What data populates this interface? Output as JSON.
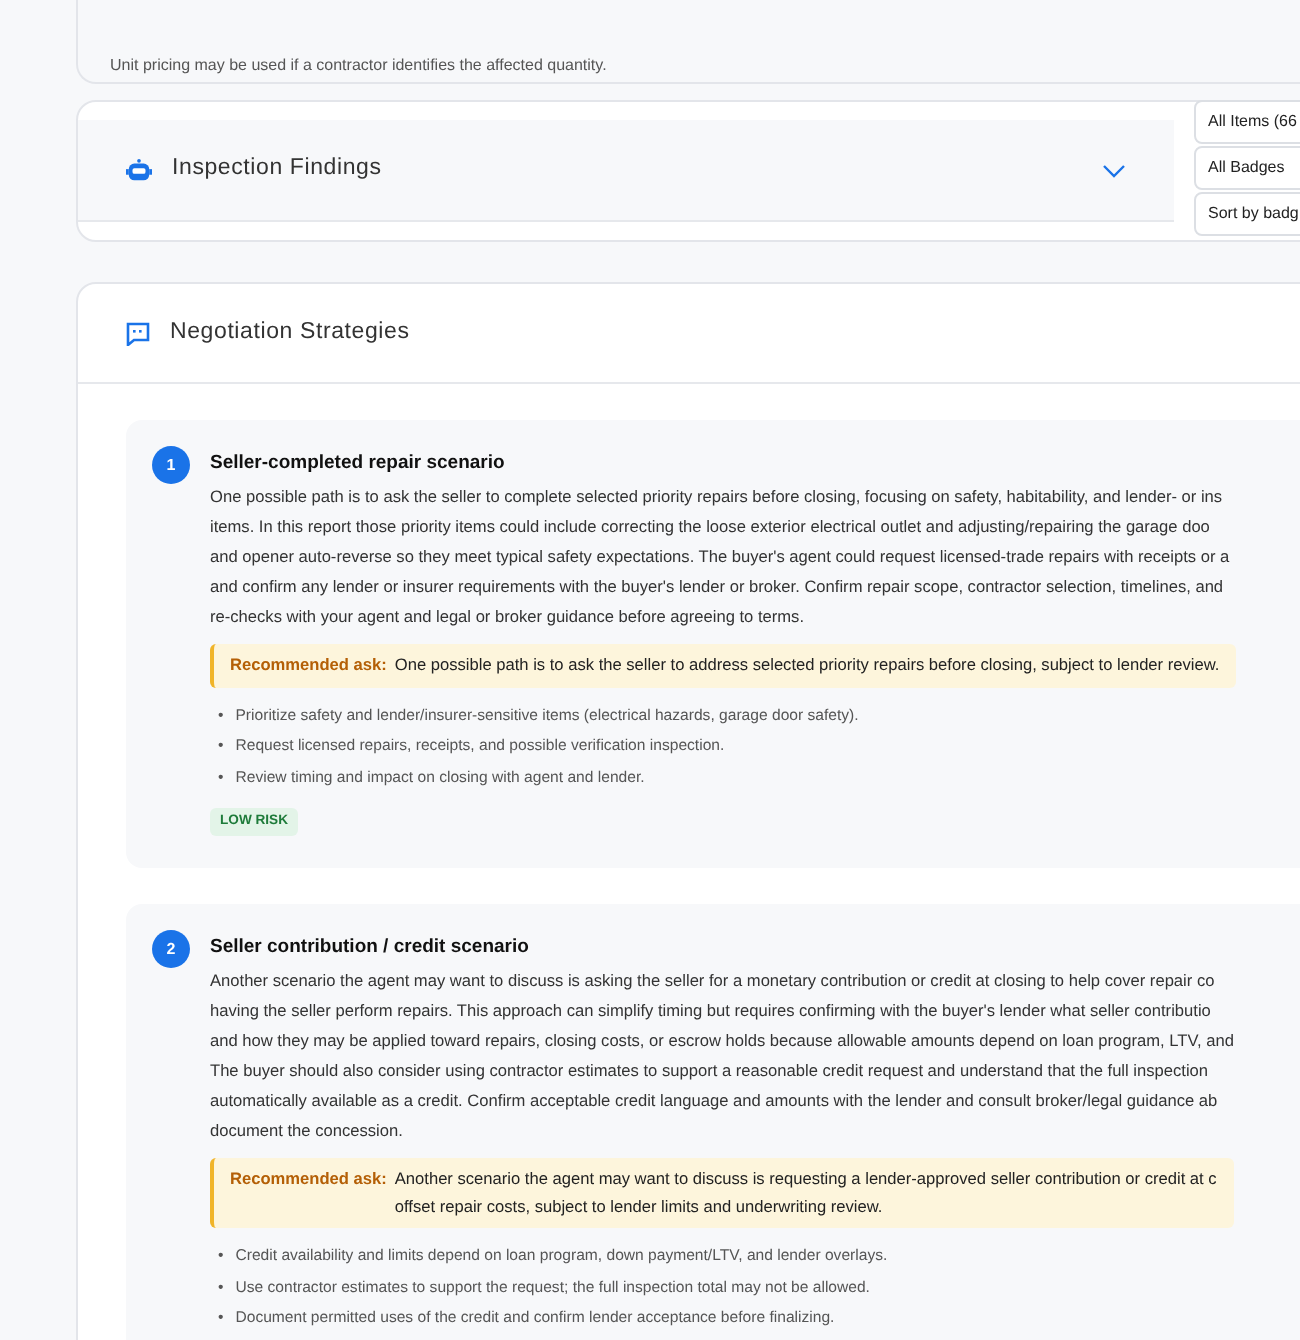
{
  "previous_note": "Unit pricing may be used if a contractor identifies the affected quantity.",
  "inspection_findings": {
    "title": "Inspection Findings",
    "expanded": false,
    "filters": [
      "All Items (66",
      "All Badges",
      "Sort by badg"
    ]
  },
  "negotiation": {
    "title": "Negotiation Strategies",
    "strategies": [
      {
        "number": "1",
        "title": "Seller-completed repair scenario",
        "body": "One possible path is to ask the seller to complete selected priority repairs before closing, focusing on safety, habitability, and lender- or ins\nitems. In this report those priority items could include correcting the loose exterior electrical outlet and adjusting/repairing the garage doo\nand opener auto-reverse so they meet typical safety expectations. The buyer's agent could request licensed-trade repairs with receipts or a\nand confirm any lender or insurer requirements with the buyer's lender or broker. Confirm repair scope, contractor selection, timelines, and\nre-checks with your agent and legal or broker guidance before agreeing to terms.",
        "ask_label": "Recommended ask:",
        "ask": "One possible path is to ask the seller to address selected priority repairs before closing, subject to lender review.",
        "points": [
          {
            "marker": "•",
            "text": "Prioritize safety and lender/insurer-sensitive items (electrical hazards, garage door safety)."
          },
          {
            "marker": "•",
            "text": "Request licensed repairs, receipts, and possible verification inspection."
          },
          {
            "marker": "•",
            "text": "Review timing and impact on closing with agent and lender."
          }
        ],
        "risk": {
          "label": "LOW RISK"
        }
      },
      {
        "number": "2",
        "title": "Seller contribution / credit scenario",
        "body": "Another scenario the agent may want to discuss is asking the seller for a monetary contribution or credit at closing to help cover repair co\nhaving the seller perform repairs. This approach can simplify timing but requires confirming with the buyer's lender what seller contributio\nand how they may be applied toward repairs, closing costs, or escrow holds because allowable amounts depend on loan program, LTV, and\nThe buyer should also consider using contractor estimates to support a reasonable credit request and understand that the full inspection\nautomatically available as a credit. Confirm acceptable credit language and amounts with the lender and consult broker/legal guidance ab\ndocument the concession.",
        "ask_label": "Recommended ask:",
        "ask": "Another scenario the agent may want to discuss is requesting a lender-approved seller contribution or credit at c\noffset repair costs, subject to lender limits and underwriting review.",
        "points": [
          {
            "marker": "•",
            "text": "Credit availability and limits depend on loan program, down payment/LTV, and lender overlays."
          },
          {
            "marker": "•",
            "text": "Use contractor estimates to support the request; the full inspection total may not be allowed."
          },
          {
            "marker": "•",
            "text": "Document permitted uses of the credit and confirm lender acceptance before finalizing."
          }
        ]
      }
    ]
  }
}
